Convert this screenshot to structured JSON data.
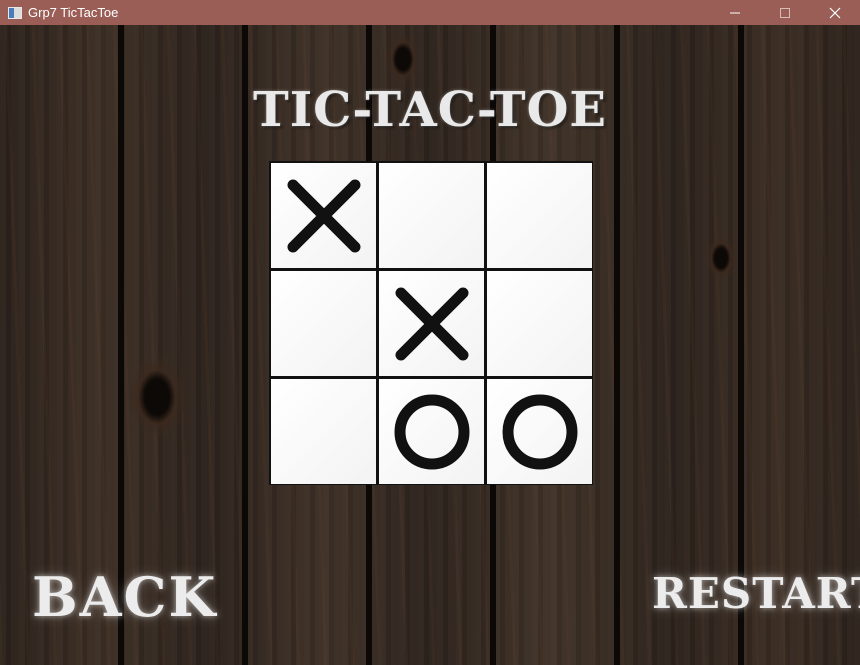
{
  "window": {
    "title": "Grp7 TicTacToe",
    "app_icon": "window-app-icon",
    "controls": [
      "minimize-icon",
      "maximize-icon",
      "close-icon"
    ]
  },
  "game": {
    "title": "TIC-TAC-TOE",
    "board": [
      [
        "X",
        "",
        ""
      ],
      [
        "",
        "X",
        ""
      ],
      [
        "",
        "O",
        "O"
      ]
    ]
  },
  "buttons": {
    "back": "BACK",
    "restart": "RESTART"
  },
  "colors": {
    "titlebar": "#9a5e56",
    "board_line": "#111111",
    "cell": "#ffffff",
    "mark": "#111111",
    "button_text": "#ececec"
  }
}
